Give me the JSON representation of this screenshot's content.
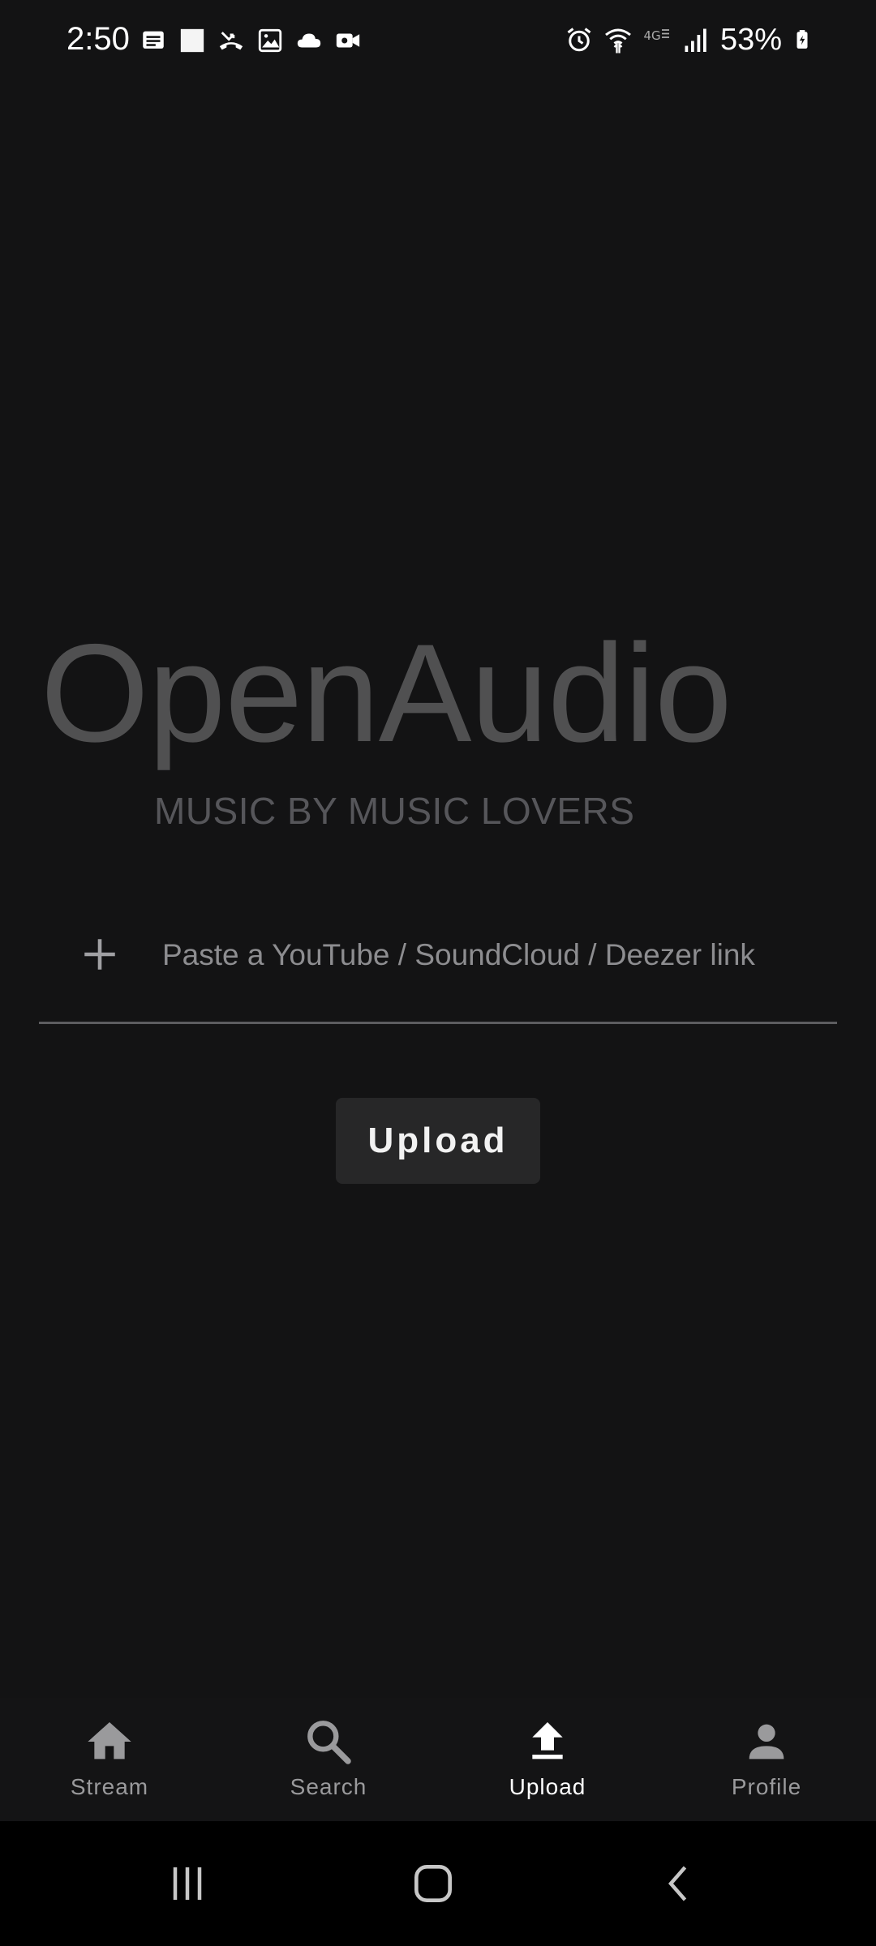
{
  "status_bar": {
    "time": "2:50",
    "left_icons": [
      "message-icon",
      "square-icon",
      "missed-call-icon",
      "image-icon",
      "cloud-icon",
      "video-camera-icon"
    ],
    "right_icons": [
      "alarm-icon",
      "wifi-icon",
      "4g-icon",
      "signal-icon"
    ],
    "battery_percent": "53%"
  },
  "brand": {
    "title": "OpenAudio",
    "tagline": "MUSIC BY MUSIC LOVERS"
  },
  "link_input": {
    "placeholder": "Paste a YouTube / SoundCloud / Deezer link",
    "value": ""
  },
  "upload_button": {
    "label": "Upload"
  },
  "bottom_nav": {
    "items": [
      {
        "label": "Stream",
        "icon": "home-icon",
        "active": false
      },
      {
        "label": "Search",
        "icon": "search-icon",
        "active": false
      },
      {
        "label": "Upload",
        "icon": "upload-icon",
        "active": true
      },
      {
        "label": "Profile",
        "icon": "person-icon",
        "active": false
      }
    ]
  },
  "system_nav": {
    "buttons": [
      "recents-icon",
      "home-outline-icon",
      "back-icon"
    ]
  },
  "colors": {
    "background": "#131314",
    "brand_text": "#505051",
    "active_nav": "#ffffff",
    "inactive_nav": "#9a9a9c",
    "button_bg": "#272728"
  }
}
